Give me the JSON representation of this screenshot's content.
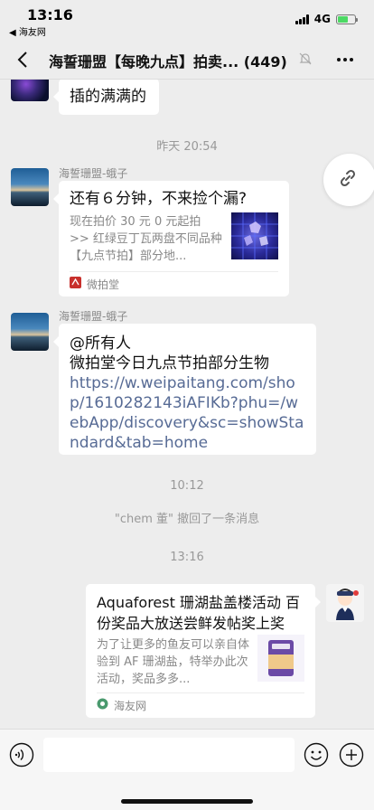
{
  "status_bar": {
    "time": "13:16",
    "back_app": "◀ 海友网",
    "network": "4G",
    "signal_bars": 4,
    "battery_level": 0.6,
    "battery_color": "#4cd964"
  },
  "nav": {
    "title": "海誓珊盟【每晚九点】拍卖... (449)",
    "back_icon": "chevron-left-icon",
    "mute_icon": "bell-off-icon",
    "more_icon": "more-dots-icon"
  },
  "messages": [
    {
      "type": "text",
      "text": "插的满满的"
    },
    {
      "type": "timestamp",
      "text": "昨天 20:54"
    },
    {
      "type": "card",
      "sender": "海誓珊盟-蛾子",
      "title": "还有６分钟，不来捡个漏?",
      "description": "现在拍价 30 元 0 元起拍 >> 红绿豆丁瓦两盘不同品种【九点节拍】部分地...",
      "source": "微拍堂",
      "source_color": "#c8302c"
    },
    {
      "type": "text_link",
      "sender": "海誓珊盟-蛾子",
      "text": "@所有人\n微拍堂今日九点节拍部分生物",
      "link": "https://w.weipaitang.com/shop/1610282143iAFIKb?phu=/webApp/discovery&sc=showStandard&tab=home"
    },
    {
      "type": "timestamp",
      "text": "10:12"
    },
    {
      "type": "system",
      "text": "\"chem 董\" 撤回了一条消息"
    },
    {
      "type": "timestamp",
      "text": "13:16"
    },
    {
      "type": "card_self",
      "title": "Aquaforest 珊湖盐盖楼活动 百份奖品大放送尝鲜发帖奖上奖",
      "description": "为了让更多的鱼友可以亲自体验到 AF 珊湖盐，特举办此次活动，奖品多多...",
      "source": "海友网",
      "source_color": "#4a9a6e"
    }
  ],
  "input_bar": {
    "placeholder": "",
    "voice_icon": "voice-icon",
    "emoji_icon": "emoji-icon",
    "plus_icon": "plus-icon"
  },
  "colors": {
    "background": "#ededed",
    "link": "#576b95",
    "muted_text": "#999999"
  }
}
